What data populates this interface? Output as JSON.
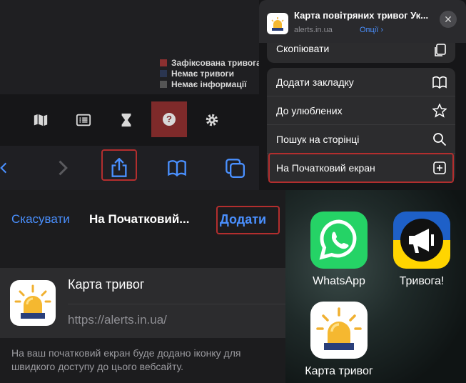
{
  "legend": {
    "items": [
      {
        "label": "Зафіксована тривога",
        "color": "#8b3030"
      },
      {
        "label": "Немає тривоги",
        "color": "#2a3550"
      },
      {
        "label": "Немає інформації",
        "color": "#555555"
      }
    ]
  },
  "app_toolbar": {
    "icons": [
      "map-icon",
      "list-icon",
      "hourglass-icon",
      "help-icon",
      "gear-icon"
    ],
    "help_label": "?"
  },
  "safari_bar": {
    "icons": [
      "back-icon",
      "forward-icon",
      "share-icon",
      "bookmarks-icon",
      "tabs-icon"
    ]
  },
  "share_sheet": {
    "title": "Карта повітряних тривог Ук...",
    "domain": "alerts.in.ua",
    "options_label": "Опції",
    "partial_item": "Скопіювати",
    "items": [
      {
        "label": "Додати закладку",
        "icon": "book-icon"
      },
      {
        "label": "До улюблених",
        "icon": "star-icon"
      },
      {
        "label": "Пошук на сторінці",
        "icon": "search-icon"
      },
      {
        "label": "На Початковий екран",
        "icon": "plus-square-icon"
      }
    ]
  },
  "add_home": {
    "cancel_label": "Скасувати",
    "title": "На Початковий...",
    "add_label": "Додати",
    "app_name": "Карта тривог",
    "url": "https://alerts.in.ua/",
    "description": "На ваш початковий екран буде додано іконку для швидкого доступу до цього вебсайту."
  },
  "home_screen": {
    "apps": [
      {
        "label": "WhatsApp",
        "color": "#25d366"
      },
      {
        "label": "Тривога!",
        "color": "#ffd500"
      },
      {
        "label": "Карта тривог",
        "color": "#ffffff"
      }
    ]
  },
  "colors": {
    "accent": "#4a90ff",
    "highlight": "#b32e2e"
  }
}
